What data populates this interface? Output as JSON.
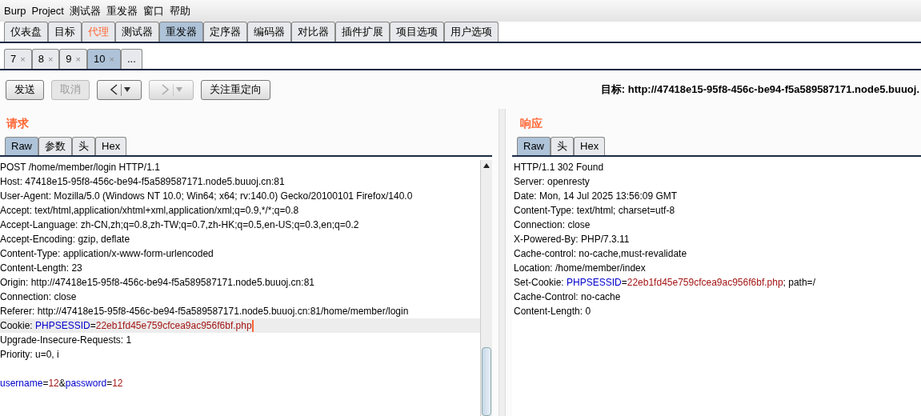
{
  "menu": [
    "Burp",
    "Project",
    "测试器",
    "重发器",
    "窗口",
    "帮助"
  ],
  "main_tabs": [
    {
      "label": "仪表盘",
      "selected": false,
      "highlighted": false
    },
    {
      "label": "目标",
      "selected": false,
      "highlighted": false
    },
    {
      "label": "代理",
      "selected": false,
      "highlighted": true
    },
    {
      "label": "测试器",
      "selected": false,
      "highlighted": false
    },
    {
      "label": "重发器",
      "selected": true,
      "highlighted": false
    },
    {
      "label": "定序器",
      "selected": false,
      "highlighted": false
    },
    {
      "label": "编码器",
      "selected": false,
      "highlighted": false
    },
    {
      "label": "对比器",
      "selected": false,
      "highlighted": false
    },
    {
      "label": "插件扩展",
      "selected": false,
      "highlighted": false
    },
    {
      "label": "项目选项",
      "selected": false,
      "highlighted": false
    },
    {
      "label": "用户选项",
      "selected": false,
      "highlighted": false
    }
  ],
  "sub_tabs": [
    {
      "label": "7",
      "close": "×",
      "selected": false
    },
    {
      "label": "8",
      "close": "×",
      "selected": false
    },
    {
      "label": "9",
      "close": "×",
      "selected": false
    },
    {
      "label": "10",
      "close": "×",
      "selected": true
    },
    {
      "label": "...",
      "selected": false
    }
  ],
  "toolbar": [
    {
      "kind": "button",
      "label": "发送",
      "disabled": false
    },
    {
      "kind": "button",
      "label": "取消",
      "disabled": true
    },
    {
      "kind": "back",
      "disabled": false
    },
    {
      "kind": "forward",
      "disabled": true
    },
    {
      "kind": "button",
      "label": "关注重定向",
      "disabled": false
    }
  ],
  "target": {
    "label": "目标:",
    "url": "http://47418e15-95f8-456c-be94-f5a589587171.node5.buuoj."
  },
  "request": {
    "title": "请求",
    "tabs": [
      {
        "label": "Raw",
        "selected": true
      },
      {
        "label": "参数",
        "selected": false
      },
      {
        "label": "头",
        "selected": false
      },
      {
        "label": "Hex",
        "selected": false
      }
    ],
    "lines": [
      {
        "current": false,
        "segments": [
          {
            "kind": "plain",
            "text": "POST /home/member/login HTTP/1.1"
          }
        ]
      },
      {
        "current": false,
        "segments": [
          {
            "kind": "plain",
            "text": "Host: 47418e15-95f8-456c-be94-f5a589587171.node5.buuoj.cn:81"
          }
        ]
      },
      {
        "current": false,
        "segments": [
          {
            "kind": "plain",
            "text": "User-Agent: Mozilla/5.0 (Windows NT 10.0; Win64; x64; rv:140.0) Gecko/20100101 Firefox/140.0"
          }
        ]
      },
      {
        "current": false,
        "segments": [
          {
            "kind": "plain",
            "text": "Accept: text/html,application/xhtml+xml,application/xml;q=0.9,*/*;q=0.8"
          }
        ]
      },
      {
        "current": false,
        "segments": [
          {
            "kind": "plain",
            "text": "Accept-Language: zh-CN,zh;q=0.8,zh-TW;q=0.7,zh-HK;q=0.5,en-US;q=0.3,en;q=0.2"
          }
        ]
      },
      {
        "current": false,
        "segments": [
          {
            "kind": "plain",
            "text": "Accept-Encoding: gzip, deflate"
          }
        ]
      },
      {
        "current": false,
        "segments": [
          {
            "kind": "plain",
            "text": "Content-Type: application/x-www-form-urlencoded"
          }
        ]
      },
      {
        "current": false,
        "segments": [
          {
            "kind": "plain",
            "text": "Content-Length: 23"
          }
        ]
      },
      {
        "current": false,
        "segments": [
          {
            "kind": "plain",
            "text": "Origin: http://47418e15-95f8-456c-be94-f5a589587171.node5.buuoj.cn:81"
          }
        ]
      },
      {
        "current": false,
        "segments": [
          {
            "kind": "plain",
            "text": "Connection: close"
          }
        ]
      },
      {
        "current": false,
        "segments": [
          {
            "kind": "plain",
            "text": "Referer: http://47418e15-95f8-456c-be94-f5a589587171.node5.buuoj.cn:81/home/member/login"
          }
        ]
      },
      {
        "current": true,
        "segments": [
          {
            "kind": "plain",
            "text": "Cookie: "
          },
          {
            "kind": "name",
            "text": "PHPSESSID"
          },
          {
            "kind": "plain",
            "text": "="
          },
          {
            "kind": "value",
            "text": "22eb1fd45e759cfcea9ac956f6bf.php"
          }
        ]
      },
      {
        "current": false,
        "segments": [
          {
            "kind": "plain",
            "text": "Upgrade-Insecure-Requests: 1"
          }
        ]
      },
      {
        "current": false,
        "segments": [
          {
            "kind": "plain",
            "text": "Priority: u=0, i"
          }
        ]
      },
      {
        "current": false
      },
      {
        "current": false,
        "segments": [
          {
            "kind": "name",
            "text": "username"
          },
          {
            "kind": "plain",
            "text": "="
          },
          {
            "kind": "value",
            "text": "12"
          },
          {
            "kind": "plain",
            "text": "&"
          },
          {
            "kind": "name",
            "text": "password"
          },
          {
            "kind": "plain",
            "text": "="
          },
          {
            "kind": "value",
            "text": "12"
          }
        ]
      }
    ]
  },
  "response": {
    "title": "响应",
    "tabs": [
      {
        "label": "Raw",
        "selected": true
      },
      {
        "label": "头",
        "selected": false
      },
      {
        "label": "Hex",
        "selected": false
      }
    ],
    "lines": [
      {
        "segments": [
          {
            "kind": "plain",
            "text": "HTTP/1.1 302 Found"
          }
        ]
      },
      {
        "segments": [
          {
            "kind": "plain",
            "text": "Server: openresty"
          }
        ]
      },
      {
        "segments": [
          {
            "kind": "plain",
            "text": "Date: Mon, 14 Jul 2025 13:56:09 GMT"
          }
        ]
      },
      {
        "segments": [
          {
            "kind": "plain",
            "text": "Content-Type: text/html; charset=utf-8"
          }
        ]
      },
      {
        "segments": [
          {
            "kind": "plain",
            "text": "Connection: close"
          }
        ]
      },
      {
        "segments": [
          {
            "kind": "plain",
            "text": "X-Powered-By: PHP/7.3.11"
          }
        ]
      },
      {
        "segments": [
          {
            "kind": "plain",
            "text": "Cache-control: no-cache,must-revalidate"
          }
        ]
      },
      {
        "segments": [
          {
            "kind": "plain",
            "text": "Location: /home/member/index"
          }
        ]
      },
      {
        "segments": [
          {
            "kind": "plain",
            "text": "Set-Cookie: "
          },
          {
            "kind": "name",
            "text": "PHPSESSID"
          },
          {
            "kind": "plain",
            "text": "="
          },
          {
            "kind": "value",
            "text": "22eb1fd45e759cfcea9ac956f6bf.php"
          },
          {
            "kind": "plain",
            "text": "; path=/"
          }
        ]
      },
      {
        "segments": [
          {
            "kind": "plain",
            "text": "Cache-Control: no-cache"
          }
        ]
      },
      {
        "segments": [
          {
            "kind": "plain",
            "text": "Content-Length: 0"
          }
        ]
      }
    ]
  }
}
